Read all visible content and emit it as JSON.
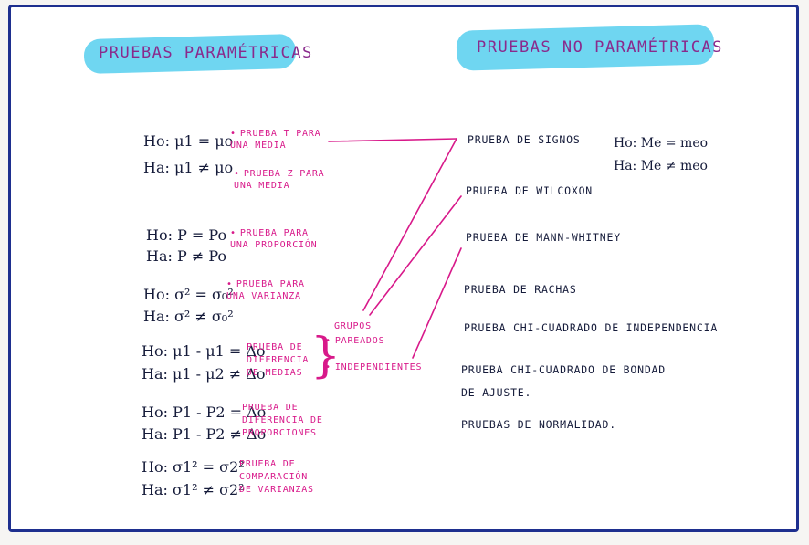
{
  "titles": {
    "parametric": "PRUEBAS PARAMÉTRICAS",
    "nonparametric": "PRUEBAS NO PARAMÉTRICAS"
  },
  "hypotheses": [
    {
      "h0": "Ho: μ1 = μo",
      "ha": "Ha: μ1 ≠ μo"
    },
    {
      "h0": "Ho: P = Po",
      "ha": "Ha: P ≠ Po"
    },
    {
      "h0": "Ho: σ² = σ₀²",
      "ha": "Ha: σ² ≠ σ₀²"
    },
    {
      "h0": "Ho: μ1 - μ1 = Δo",
      "ha": "Ha: μ1 - μ2 ≠ Δo"
    },
    {
      "h0": "Ho: P1 - P2 = Δo",
      "ha": "Ha: P1 - P2 ≠ Δo"
    },
    {
      "h0": "Ho: σ1² = σ2²",
      "ha": "Ha: σ1² ≠ σ2²"
    }
  ],
  "parametric_tests": {
    "t_media": "Prueba t para una media",
    "z_media": "Prueba z para una media",
    "proporcion": "Prueba para una proporción",
    "varianza": "Prueba para una varianza",
    "dif_medias": "Prueba de diferencia de medias",
    "grupos": "Grupos",
    "pareados": "Pareados",
    "independientes": "Independientes",
    "dif_proporciones": "Prueba de diferencia de proporciones",
    "comp_varianzas": "Prueba de comparación de varianzas"
  },
  "median_hypothesis": {
    "h0": "Ho: Me = meo",
    "ha": "Ha: Me ≠ meo"
  },
  "nonparametric_tests": [
    "PRUEBA DE SIGNOS",
    "PRUEBA DE WILCOXON",
    "PRUEBA DE MANN-WHITNEY",
    "PRUEBA DE RACHAS",
    "PRUEBA CHI-CUADRADO DE INDEPENDENCIA",
    "PRUEBA CHI-CUADRADO DE BONDAD DE AJUSTE.",
    "PRUEBAS DE NORMALIDAD."
  ],
  "colors": {
    "ink": "#151b3a",
    "magenta": "#d8198a",
    "highlight": "#5fd2ef",
    "frame": "#1e2f8f"
  }
}
